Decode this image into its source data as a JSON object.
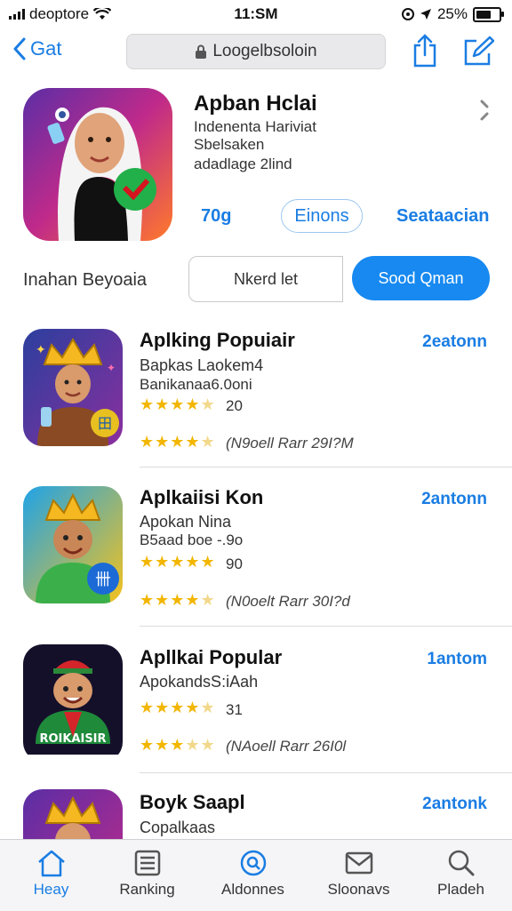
{
  "status_bar": {
    "carrier": "deoptore",
    "time": "11:SM",
    "battery": "25%"
  },
  "nav": {
    "back_label": "Gat",
    "url": "Loogelbsoloin"
  },
  "app": {
    "name": "Apban Hclai",
    "subtitle1": "Indenenta Hariviat",
    "subtitle2": "Sbelsaken",
    "subtitle3": "adadlage 2lind",
    "price": "70g",
    "get_label": "Einons",
    "secondary_label": "Seataacian"
  },
  "segment": {
    "label": "Inahan Beyoaia",
    "option1": "Nkerd let",
    "option2": "Sood Qman"
  },
  "list": [
    {
      "title": "Aplking Popuiair",
      "developer": "Bapkas Laokem4",
      "size": "Banikanaa6.0oni",
      "rating": 4.5,
      "rating_count": "20",
      "review_rating": 4.5,
      "review_text": "(N9oell Rarr 29I?M",
      "action": "2eatonn"
    },
    {
      "title": "Aplkaiisi Kon",
      "developer": "Apokan Nina",
      "size": "B5aad boe -.9o",
      "rating": 5,
      "rating_count": "90",
      "review_rating": 4.5,
      "review_text": "(N0oelt Rarr 30I?d",
      "action": "2antonn"
    },
    {
      "title": "Apllkai Popular",
      "developer": "ApokandsS:iAah",
      "size": "",
      "rating": 4.5,
      "rating_count": "31",
      "review_rating": 3.5,
      "review_text": "(NAoell Rarr 26I0l",
      "action": "1antom"
    },
    {
      "title": "Boyk Saapl",
      "developer": "Copalkaas",
      "size": "",
      "action": "2antonk"
    }
  ],
  "thumb_texts": {
    "item1_badge": "田",
    "item2_badge": "卌",
    "item3_caption": "ROIKAISIR"
  },
  "tabs": [
    {
      "label": "Heay",
      "icon": "home-icon",
      "active": true
    },
    {
      "label": "Ranking",
      "icon": "ranking-list-icon",
      "active": false
    },
    {
      "label": "Aldonnes",
      "icon": "search-circle-icon",
      "active": false
    },
    {
      "label": "Sloonavs",
      "icon": "mail-icon",
      "active": false
    },
    {
      "label": "Pladeh",
      "icon": "search-icon",
      "active": false
    }
  ],
  "colors": {
    "accent": "#1a7de3",
    "segment_active": "#1789f0",
    "star": "#f2b600"
  }
}
